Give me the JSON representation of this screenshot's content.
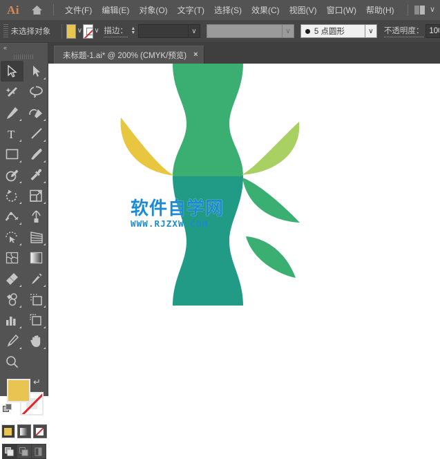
{
  "app": {
    "logo_text": "Ai",
    "home_icon": "home-icon"
  },
  "menubar": {
    "items": [
      {
        "label": "文件(F)",
        "name": "menu-file"
      },
      {
        "label": "编辑(E)",
        "name": "menu-edit"
      },
      {
        "label": "对象(O)",
        "name": "menu-object"
      },
      {
        "label": "文字(T)",
        "name": "menu-type"
      },
      {
        "label": "选择(S)",
        "name": "menu-select"
      },
      {
        "label": "效果(C)",
        "name": "menu-effect"
      },
      {
        "label": "视图(V)",
        "name": "menu-view"
      },
      {
        "label": "窗口(W)",
        "name": "menu-window"
      },
      {
        "label": "帮助(H)",
        "name": "menu-help"
      }
    ],
    "workspace_caret": "∨"
  },
  "controlbar": {
    "selection_status": "未选择对象",
    "fill_color": "#e8c552",
    "fill_caret": "∨",
    "stroke_swatch": "none",
    "stroke_caret": "∨",
    "stroke_label": "描边：",
    "stroke_weight_value": "",
    "stroke_weight_caret": "∨",
    "stroke_profile_caret": "∨",
    "brush_label": "5 点圆形",
    "brush_caret": "∨",
    "opacity_label": "不透明度：",
    "opacity_value": "100"
  },
  "tabbar": {
    "document_title": "未标题-1.ai* @ 200% (CMYK/预览)",
    "close_label": "×"
  },
  "toolbar": {
    "collapse_label": "«",
    "tools": [
      {
        "name": "selection-tool",
        "active": true
      },
      {
        "name": "direct-selection-tool",
        "active": false
      },
      {
        "name": "magic-wand-tool",
        "active": false
      },
      {
        "name": "lasso-tool",
        "active": false
      },
      {
        "name": "pen-tool",
        "active": false
      },
      {
        "name": "curvature-tool",
        "active": false
      },
      {
        "name": "type-tool",
        "active": false
      },
      {
        "name": "line-segment-tool",
        "active": false
      },
      {
        "name": "rectangle-tool",
        "active": false
      },
      {
        "name": "paintbrush-tool",
        "active": false
      },
      {
        "name": "shaper-tool",
        "active": false
      },
      {
        "name": "eyedropper-tool",
        "active": false
      },
      {
        "name": "rotate-tool",
        "active": false
      },
      {
        "name": "scale-tool",
        "active": false
      },
      {
        "name": "width-tool",
        "active": false
      },
      {
        "name": "free-transform-tool",
        "active": false
      },
      {
        "name": "shape-builder-tool",
        "active": false
      },
      {
        "name": "perspective-grid-tool",
        "active": false
      },
      {
        "name": "mesh-tool",
        "active": false
      },
      {
        "name": "gradient-tool",
        "active": false
      },
      {
        "name": "eraser-tool",
        "active": false
      },
      {
        "name": "scissors-tool",
        "active": false
      },
      {
        "name": "symbol-sprayer-tool",
        "active": false
      },
      {
        "name": "artboard-tool",
        "active": false
      },
      {
        "name": "column-graph-tool",
        "active": false
      },
      {
        "name": "slice-tool",
        "active": false
      },
      {
        "name": "pencil-tool",
        "active": false
      },
      {
        "name": "hand-tool",
        "active": false
      },
      {
        "name": "zoom-tool",
        "active": false
      }
    ],
    "fill_color": "#e8c552",
    "stroke_color": "none",
    "swap_icon": "swap-fill-stroke-icon",
    "color_modes": [
      {
        "name": "color-mode-flat",
        "selected": true
      },
      {
        "name": "color-mode-gradient",
        "selected": false
      },
      {
        "name": "color-mode-none",
        "selected": false
      }
    ],
    "draw_modes": [
      {
        "name": "draw-normal-mode",
        "selected": true
      },
      {
        "name": "draw-behind-mode",
        "selected": false
      },
      {
        "name": "draw-inside-mode",
        "selected": false
      }
    ]
  },
  "canvas": {
    "watermark_cn": "软件自学网",
    "watermark_en": "WWW.RJZXW.COM",
    "watermark_color": "#1a8ad4",
    "background": "#ffffff",
    "artwork": {
      "name": "bamboo-plant-illustration",
      "colors": {
        "upper_stalk": "#3aaf71",
        "lower_stalk": "#229b86",
        "leaf_yellow": "#e8c63f",
        "leaf_light_green": "#a9d063",
        "leaf_green": "#3aaf71"
      },
      "shapes": [
        {
          "name": "leaf-left-yellow",
          "color": "#e8c63f"
        },
        {
          "name": "leaf-right-upper-light-green",
          "color": "#a9d063"
        },
        {
          "name": "leaf-right-lower-green",
          "color": "#3aaf71"
        },
        {
          "name": "stalk-upper-green",
          "color": "#3aaf71"
        },
        {
          "name": "stalk-lower-teal",
          "color": "#229b86"
        }
      ]
    }
  }
}
